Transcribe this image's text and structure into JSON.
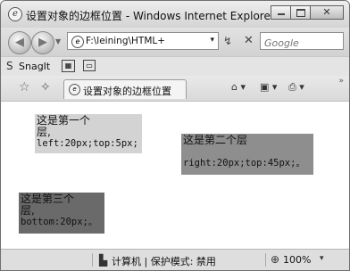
{
  "window": {
    "title": "设置对象的边框位置 - Windows Internet Explorer",
    "app_icon_glyph": "e"
  },
  "address": {
    "url": "F:\\leining\\HTML+",
    "search_placeholder": "Google"
  },
  "toolbar": {
    "snagit_label": "SnagIt"
  },
  "tab": {
    "label": "设置对象的边框位置"
  },
  "content": {
    "layer1": {
      "line1": "这是第一个",
      "line2": "层,",
      "line3": "left:20px;top:5px;"
    },
    "layer2": {
      "line1": "这是第二个层",
      "line2": "right:20px;top:45px;。"
    },
    "layer3": {
      "line1": "这是第三个",
      "line2": "层,",
      "line3": "bottom:20px;。"
    }
  },
  "statusbar": {
    "zone": "计算机 | 保护模式: 禁用",
    "zoom": "100%"
  },
  "colors": {
    "layer1_bg": "#d3d3d3",
    "layer2_bg": "#8e8e8e",
    "layer3_bg": "#6a6a6a"
  }
}
